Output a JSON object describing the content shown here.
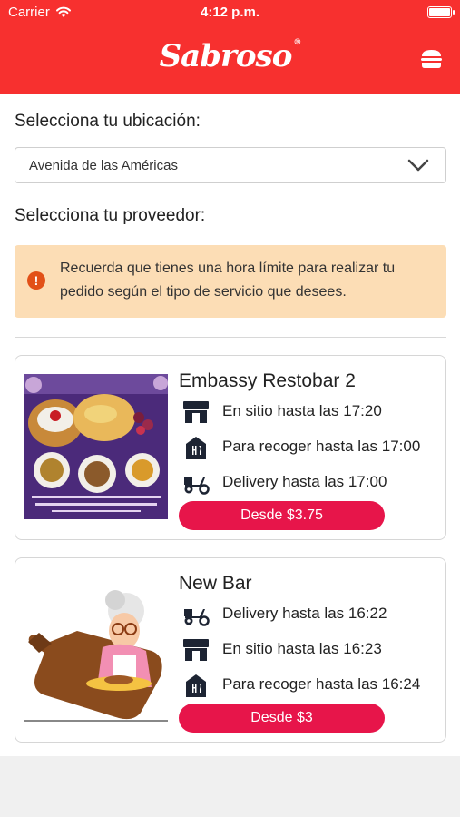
{
  "status": {
    "carrier": "Carrier",
    "time": "4:12 p.m."
  },
  "header": {
    "logo": "Sabroso",
    "logo_mark": "®"
  },
  "location": {
    "label": "Selecciona tu ubicación:",
    "value": "Avenida de las Américas"
  },
  "provider": {
    "label": "Selecciona tu proveedor:"
  },
  "alert": {
    "text": "Recuerda que tienes una hora límite para realizar tu pedido según el tipo de servicio que desees."
  },
  "providers": [
    {
      "name": "Embassy Restobar 2",
      "image": "food-photo",
      "services": [
        {
          "icon": "store-icon",
          "text": "En sitio hasta las 17:20"
        },
        {
          "icon": "takeaway-icon",
          "text": "Para recoger hasta las 17:00"
        },
        {
          "icon": "scooter-icon",
          "text": "Delivery hasta las 17:00"
        }
      ],
      "price_button": "Desde $3.75"
    },
    {
      "name": "New Bar",
      "image": "grandma-cook-illustration",
      "services": [
        {
          "icon": "scooter-icon",
          "text": "Delivery hasta las 16:22"
        },
        {
          "icon": "store-icon",
          "text": "En sitio hasta las 16:23"
        },
        {
          "icon": "takeaway-icon",
          "text": "Para recoger hasta las 16:24"
        }
      ],
      "price_button": "Desde $3"
    }
  ],
  "colors": {
    "header": "#f7302f",
    "button": "#e7154a",
    "alert_bg": "#fcddb5",
    "alert_icon": "#e25017"
  }
}
